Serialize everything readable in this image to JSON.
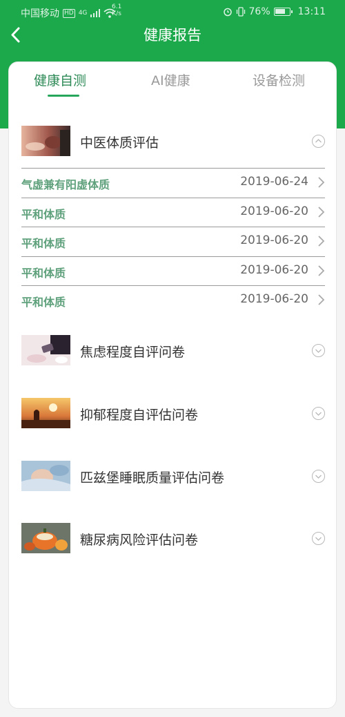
{
  "status_bar": {
    "carrier": "中国移动",
    "hd": "HD",
    "net": "4G",
    "speed_value": "6.1",
    "speed_unit": "K/s",
    "battery": "76%",
    "battery_fraction": 0.76,
    "time": "13:11"
  },
  "header": {
    "title": "健康报告",
    "back_icon": "chevron-left-icon"
  },
  "colors": {
    "brand_green": "#1ca94b",
    "active_tab": "#2e8b57",
    "record_label": "#5fa17c"
  },
  "tabs": [
    {
      "label": "健康自测",
      "active": true
    },
    {
      "label": "AI健康",
      "active": false
    },
    {
      "label": "设备检测",
      "active": false
    }
  ],
  "sections": [
    {
      "title": "中医体质评估",
      "expanded": true,
      "records": [
        {
          "label": "气虚兼有阳虚体质",
          "date": "2019-06-24"
        },
        {
          "label": "平和体质",
          "date": "2019-06-20"
        },
        {
          "label": "平和体质",
          "date": "2019-06-20"
        },
        {
          "label": "平和体质",
          "date": "2019-06-20"
        },
        {
          "label": "平和体质",
          "date": "2019-06-20"
        }
      ]
    },
    {
      "title": "焦虑程度自评问卷",
      "expanded": false
    },
    {
      "title": "抑郁程度自评估问卷",
      "expanded": false
    },
    {
      "title": "匹兹堡睡眠质量评估问卷",
      "expanded": false
    },
    {
      "title": "糖尿病风险评估问卷",
      "expanded": false
    }
  ]
}
